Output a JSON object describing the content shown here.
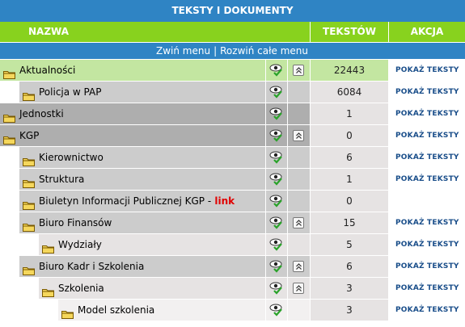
{
  "header": {
    "title": "TEKSTY I DOKUMENTY",
    "col_name": "NAZWA",
    "col_texts": "TEKSTÓW",
    "col_action": "AKCJA"
  },
  "menu": {
    "collapse": "Zwiń menu",
    "separator": "|",
    "expand": "Rozwiń całe menu"
  },
  "colors": {
    "title_blue": "#2f84c4",
    "header_green": "#88d21e",
    "row_highlight": "#c3e6a1",
    "action_blue": "#1a4e8a",
    "link_red": "#e00000"
  },
  "rows": [
    {
      "level": 0,
      "name": "Aktualności",
      "count": "22443",
      "action": "POKAŻ TEKSTY",
      "expandable": true,
      "highlighted": true
    },
    {
      "level": 1,
      "name": "Policja w PAP",
      "count": "6084",
      "action": "POKAŻ TEKSTY",
      "expandable": false
    },
    {
      "level": 0,
      "name": "Jednostki",
      "count": "1",
      "action": "POKAŻ TEKSTY",
      "expandable": false
    },
    {
      "level": 0,
      "name": "KGP",
      "count": "0",
      "action": "POKAŻ TEKSTY",
      "expandable": true
    },
    {
      "level": 1,
      "name": "Kierownictwo",
      "count": "6",
      "action": "POKAŻ TEKSTY",
      "expandable": false
    },
    {
      "level": 1,
      "name": "Struktura",
      "count": "1",
      "action": "POKAŻ TEKSTY",
      "expandable": false
    },
    {
      "level": 1,
      "name": "Biuletyn Informacji Publicznej KGP -",
      "link": "link",
      "count": "0",
      "action": "",
      "expandable": false
    },
    {
      "level": 1,
      "name": "Biuro Finansów",
      "count": "15",
      "action": "POKAŻ TEKSTY",
      "expandable": true
    },
    {
      "level": 2,
      "name": "Wydziały",
      "count": "5",
      "action": "POKAŻ TEKSTY",
      "expandable": false
    },
    {
      "level": 1,
      "name": "Biuro Kadr i Szkolenia",
      "count": "6",
      "action": "POKAŻ TEKSTY",
      "expandable": true
    },
    {
      "level": 2,
      "name": "Szkolenia",
      "count": "3",
      "action": "POKAŻ TEKSTY",
      "expandable": true
    },
    {
      "level": 3,
      "name": "Model szkolenia",
      "count": "3",
      "action": "POKAŻ TEKSTY",
      "expandable": false
    }
  ]
}
